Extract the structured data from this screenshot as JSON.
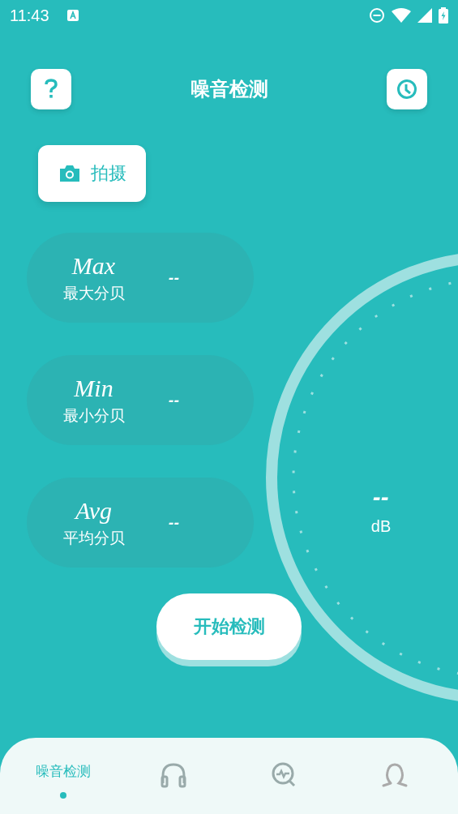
{
  "status_bar": {
    "time": "11:43"
  },
  "header": {
    "title": "噪音检测"
  },
  "camera_button": {
    "label": "拍摄"
  },
  "stats": [
    {
      "name": "Max",
      "label": "最大分贝",
      "value": "--"
    },
    {
      "name": "Min",
      "label": "最小分贝",
      "value": "--"
    },
    {
      "name": "Avg",
      "label": "平均分贝",
      "value": "--"
    }
  ],
  "gauge": {
    "value": "--",
    "unit": "dB"
  },
  "start_button": {
    "label": "开始检测"
  },
  "nav": [
    {
      "label": "噪音检测",
      "selected": true
    },
    {
      "selected": false
    },
    {
      "selected": false
    },
    {
      "selected": false
    }
  ]
}
